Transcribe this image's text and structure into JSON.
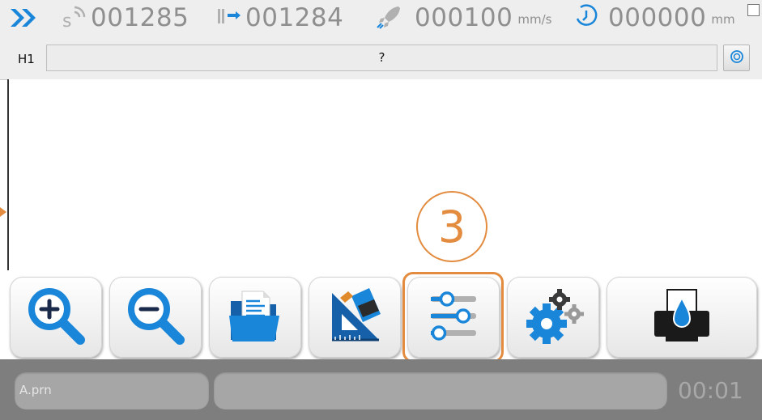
{
  "status": {
    "counter_1": "001285",
    "counter_2": "001284",
    "speed": "000100",
    "speed_unit": "mm/s",
    "distance": "000000",
    "distance_unit": "mm"
  },
  "head": {
    "label": "H1",
    "value": "?"
  },
  "callout": {
    "number": "3"
  },
  "toolbar": {
    "buttons": [
      "zoom-in-icon",
      "zoom-out-icon",
      "open-folder-icon",
      "design-tools-icon",
      "sliders-icon",
      "gears-icon",
      "print-icon"
    ]
  },
  "footer": {
    "file_name": "A.prn",
    "timer": "00:01"
  },
  "colors": {
    "accent": "#e38b3f",
    "blue": "#1a86d9",
    "status_text": "#8f8f8f",
    "footer_bg": "#7e7e7e"
  }
}
